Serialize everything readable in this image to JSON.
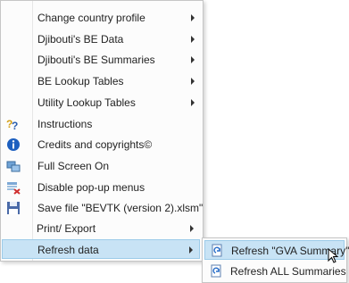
{
  "menu": {
    "items": [
      {
        "label": "Change country profile",
        "icon": "none",
        "submenu": true
      },
      {
        "label": "Djibouti's BE Data",
        "icon": "none",
        "submenu": true
      },
      {
        "label": "Djibouti's BE Summaries",
        "icon": "none",
        "submenu": true
      },
      {
        "label": "BE Lookup Tables",
        "icon": "none",
        "submenu": true
      },
      {
        "label": "Utility Lookup Tables",
        "icon": "none",
        "submenu": true
      },
      {
        "label": "Instructions",
        "icon": "help-icon",
        "submenu": false
      },
      {
        "label": "Credits and copyrights©",
        "icon": "info-icon",
        "submenu": false
      },
      {
        "label": "Full Screen On",
        "icon": "fullscreen-icon",
        "submenu": false
      },
      {
        "label": "Disable pop-up menus",
        "icon": "disable-popup-icon",
        "submenu": false
      },
      {
        "label": "Save file \"BEVTK (version 2).xlsm\"",
        "icon": "save-icon",
        "submenu": false
      },
      {
        "label": "Print/ Export",
        "icon": "none",
        "submenu": true
      },
      {
        "label": "Refresh data",
        "icon": "none",
        "submenu": true,
        "highlighted": true
      }
    ]
  },
  "submenu": {
    "items": [
      {
        "label": "Refresh \"GVA Summary\"",
        "icon": "refresh-icon",
        "highlighted": true
      },
      {
        "label": "Refresh ALL Summaries",
        "icon": "refresh-icon"
      }
    ]
  },
  "colors": {
    "highlight_bg": "#c8e3f5",
    "highlight_border": "#9ccbe9",
    "menu_bg": "#fcfcfc"
  }
}
